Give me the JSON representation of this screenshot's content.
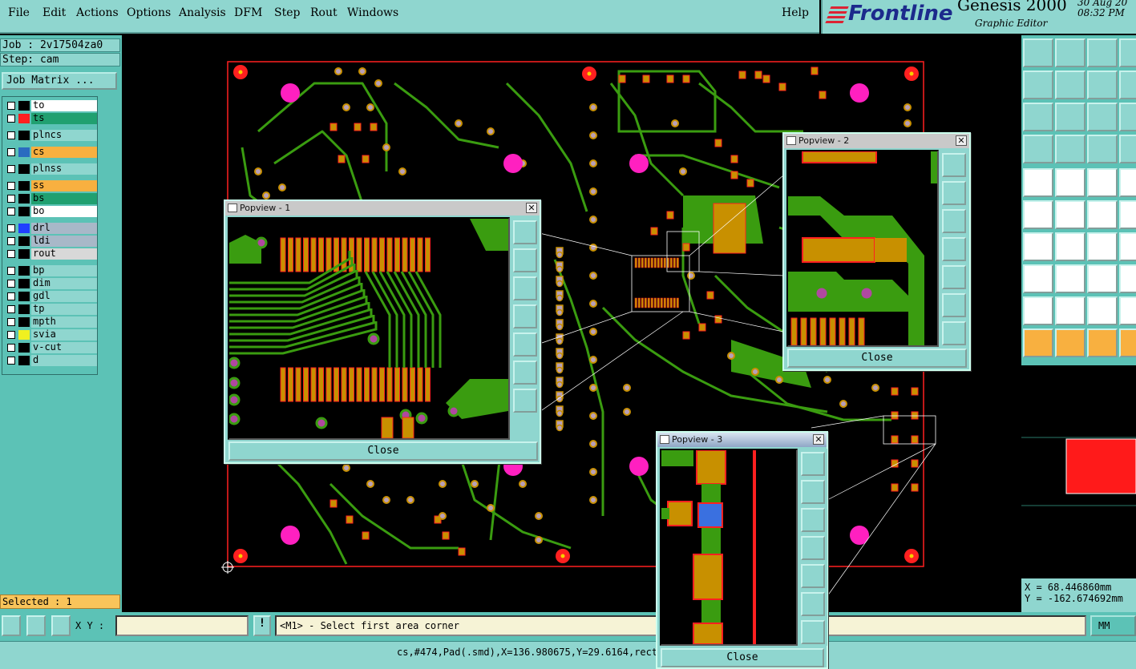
{
  "menu": {
    "items": [
      "File",
      "Edit",
      "Actions",
      "Options",
      "Analysis",
      "DFM",
      "Step",
      "Rout",
      "Windows"
    ],
    "help": "Help"
  },
  "logo": {
    "brand": "Frontline",
    "product": "Genesis 2000",
    "subtitle": "Graphic Editor",
    "date": "30 Aug 20",
    "time": "08:32 PM"
  },
  "job": {
    "job_label": "Job : 2v17504za0",
    "step_label": "Step: cam",
    "matrix_button": "Job Matrix ..."
  },
  "layers": [
    {
      "name": "to",
      "color": "#ffffff",
      "swatch": "#000000",
      "edit": true
    },
    {
      "name": "ts",
      "color": "#20a070",
      "swatch": "#ff2020",
      "edit": true
    },
    {
      "name": "plncs",
      "color": "#8fd6cf",
      "swatch": "#000000",
      "edit": false
    },
    {
      "name": "cs",
      "color": "#f8b040",
      "swatch": "#2a6cc0",
      "edit": false,
      "active": true
    },
    {
      "name": "plnss",
      "color": "#8fd6cf",
      "swatch": "#000000",
      "edit": false
    },
    {
      "name": "ss",
      "color": "#f8b040",
      "swatch": "#000000",
      "edit": true
    },
    {
      "name": "bs",
      "color": "#20a070",
      "swatch": "#000000",
      "edit": false
    },
    {
      "name": "bo",
      "color": "#ffffff",
      "swatch": "#000000",
      "edit": false
    },
    {
      "name": "drl",
      "color": "#a8b8c8",
      "swatch": "#2040ff",
      "edit": false
    },
    {
      "name": "ldi",
      "color": "#a8b8c8",
      "swatch": "#000000",
      "edit": false
    },
    {
      "name": "rout",
      "color": "#d8d8d8",
      "swatch": "#000000",
      "edit": false
    },
    {
      "name": "bp",
      "color": "#8fd6cf",
      "swatch": "#000000",
      "edit": false
    },
    {
      "name": "dim",
      "color": "#8fd6cf",
      "swatch": "#000000",
      "edit": false
    },
    {
      "name": "gdl",
      "color": "#8fd6cf",
      "swatch": "#000000",
      "edit": false
    },
    {
      "name": "tp",
      "color": "#8fd6cf",
      "swatch": "#000000",
      "edit": false
    },
    {
      "name": "mpth",
      "color": "#8fd6cf",
      "swatch": "#000000",
      "edit": false
    },
    {
      "name": "svia",
      "color": "#8fd6cf",
      "swatch": "#f0f020",
      "edit": false
    },
    {
      "name": "v-cut",
      "color": "#8fd6cf",
      "swatch": "#000000",
      "edit": false
    },
    {
      "name": "d",
      "color": "#8fd6cf",
      "swatch": "#000000",
      "edit": false
    }
  ],
  "selected_label": "Selected : 1",
  "cmd": {
    "xy_label": "X Y :",
    "xy_value": "",
    "prompt": "<M1> - Select first area corner",
    "units_button": "MM"
  },
  "coords": {
    "x": "X = 68.446860mm",
    "y": "Y = -162.674692mm"
  },
  "status_line": "cs,#474,Pad(.smd),X=136.980675,Y=29.6164,rect1",
  "popviews": [
    {
      "title": "Popview - 1",
      "close_label": "Close"
    },
    {
      "title": "Popview - 2",
      "close_label": "Close"
    },
    {
      "title": "Popview - 3",
      "close_label": "Close"
    }
  ],
  "colors": {
    "trace": "#3a9c10",
    "pad": "#c89000",
    "pad_outline": "#ff2020",
    "via": "#b8a0b8",
    "mount_hole": "#ff20c0",
    "fiducial": "#ff2020",
    "outline": "#ff2020"
  }
}
